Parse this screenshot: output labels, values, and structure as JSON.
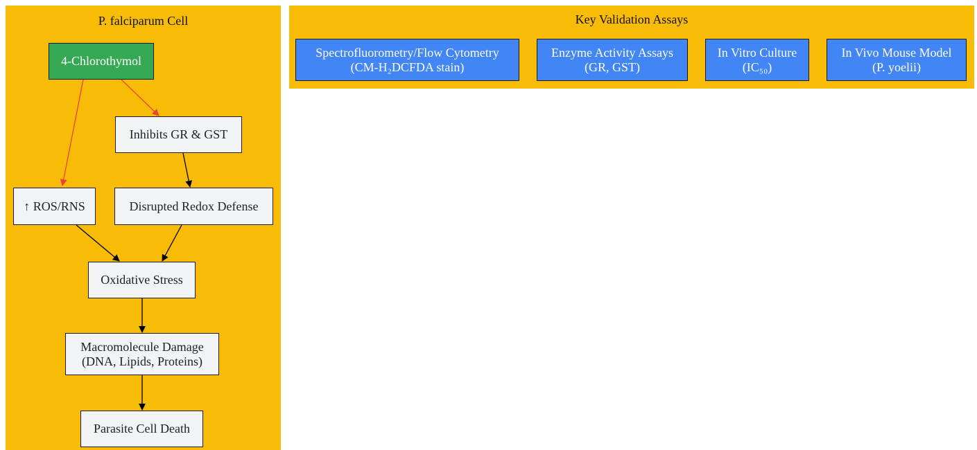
{
  "clusters": {
    "cell": {
      "title": "P. falciparum Cell"
    },
    "assays": {
      "title": "Key Validation Assays"
    }
  },
  "nodes": {
    "chlorothymol": "4-Chlorothymol",
    "inhibits": "Inhibits GR & GST",
    "ros": "↑ ROS/RNS",
    "redox": "Disrupted Redox Defense",
    "stress": "Oxidative Stress",
    "damage_line1": "Macromolecule Damage",
    "damage_line2": "(DNA, Lipids, Proteins)",
    "death": "Parasite Cell Death"
  },
  "assays": [
    {
      "line1": "Spectrofluorometry/Flow Cytometry",
      "line2": "(CM-H₂DCFDA stain)"
    },
    {
      "line1": "Enzyme Activity Assays",
      "line2": "(GR, GST)"
    },
    {
      "line1": "In Vitro Culture",
      "line2": "(IC₅₀)"
    },
    {
      "line1": "In Vivo Mouse Model",
      "line2": "(P. yoelii)"
    }
  ],
  "colors": {
    "cluster_fill": "#f9bc06",
    "node_fill": "#f1f3f4",
    "start_node_fill": "#34a853",
    "assay_fill": "#4285f4",
    "drug_edge": "#ea4335",
    "edge": "#000000"
  }
}
